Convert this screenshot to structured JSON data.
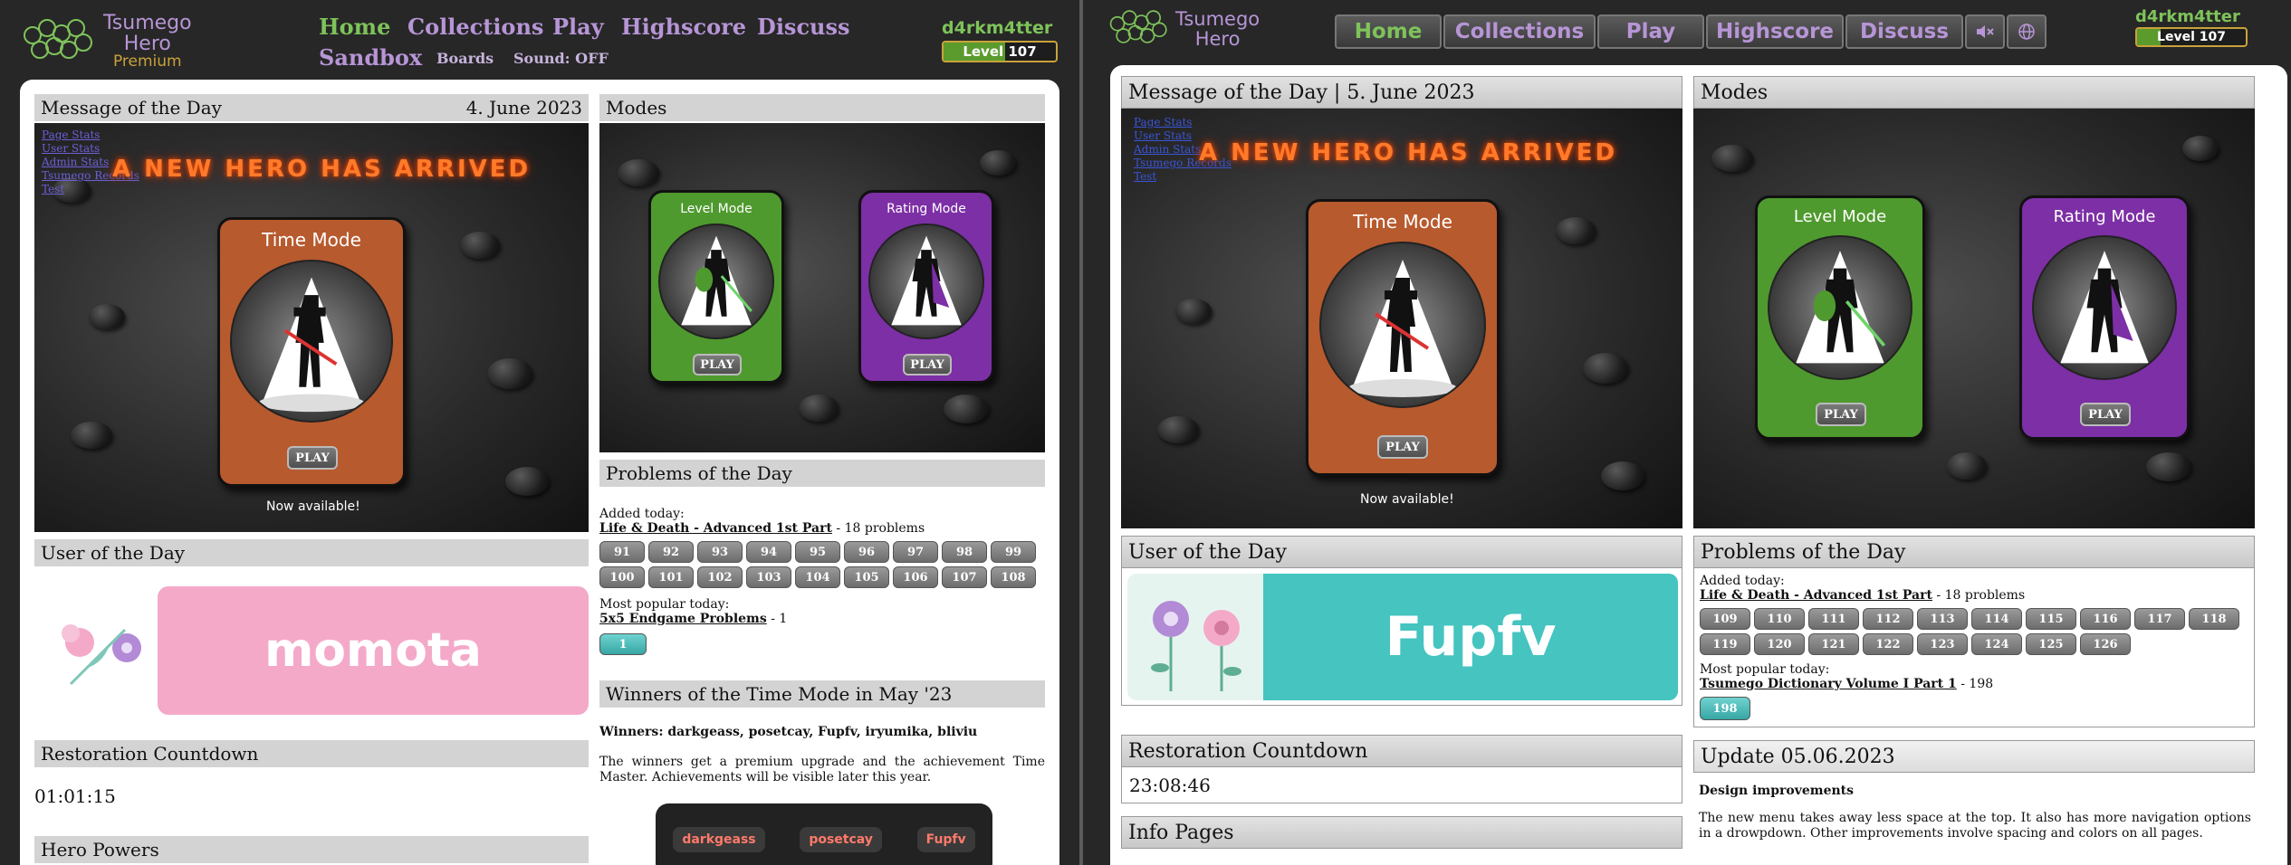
{
  "left": {
    "logo": {
      "line1": "Tsumego",
      "line2": "Hero",
      "line3": "Premium"
    },
    "nav": {
      "home": "Home",
      "collections": "Collections",
      "play": "Play",
      "highscore": "Highscore",
      "discuss": "Discuss",
      "sandbox": "Sandbox",
      "boards": "Boards",
      "sound": "Sound: OFF"
    },
    "user": {
      "name": "d4rkm4tter",
      "level": "Level 107",
      "level_progress": 0.55
    },
    "motd": {
      "title": "Message of the Day",
      "date": "4. June 2023",
      "headline": "A NEW HERO HAS ARRIVED",
      "card_title": "Time Mode",
      "play": "PLAY",
      "caption": "Now available!",
      "links": [
        "Page Stats",
        "User Stats",
        "Admin Stats",
        "Tsumego Records",
        "Test"
      ]
    },
    "modes": {
      "title": "Modes",
      "level_mode": "Level Mode",
      "rating_mode": "Rating Mode",
      "play": "PLAY"
    },
    "user_of_day": {
      "title": "User of the Day",
      "name": "momota"
    },
    "restoration": {
      "title": "Restoration Countdown",
      "time": "01:01:15"
    },
    "hero_powers": {
      "title": "Hero Powers"
    },
    "problems": {
      "title": "Problems of the Day",
      "added_label": "Added today:",
      "collection": "Life & Death - Advanced 1st Part",
      "count": " - 18 problems",
      "row1": [
        "91",
        "92",
        "93",
        "94",
        "95",
        "96",
        "97",
        "98",
        "99"
      ],
      "row2": [
        "100",
        "101",
        "102",
        "103",
        "104",
        "105",
        "106",
        "107",
        "108"
      ],
      "popular_label": "Most popular today:",
      "popular_collection": "5x5 Endgame Problems",
      "popular_count": " - 1",
      "popular_btn": "1"
    },
    "winners": {
      "title": "Winners of the Time Mode in May '23",
      "names": "Winners: darkgeass, posetcay, Fupfv, iryumika, bliviu",
      "text": "The winners get a premium upgrade and the achievement Time Master. Achievements will be visible later this year.",
      "badges": [
        "darkgeass",
        "posetcay",
        "Fupfv"
      ]
    }
  },
  "right": {
    "logo": {
      "line1": "Tsumego",
      "line2": "Hero"
    },
    "nav": [
      "Home",
      "Collections",
      "Play",
      "Highscore",
      "Discuss"
    ],
    "user": {
      "name": "d4rkm4tter",
      "level": "Level 107",
      "level_progress": 0.22
    },
    "motd": {
      "title": "Message of the Day | 5. June 2023",
      "headline": "A NEW HERO HAS ARRIVED",
      "card_title": "Time Mode",
      "play": "PLAY",
      "caption": "Now available!",
      "links": [
        "Page Stats",
        "User Stats",
        "Admin Stats",
        "Tsumego Records",
        "Test"
      ]
    },
    "modes": {
      "title": "Modes",
      "level_mode": "Level Mode",
      "rating_mode": "Rating Mode",
      "play": "PLAY"
    },
    "user_of_day": {
      "title": "User of the Day",
      "name": "Fupfv"
    },
    "restoration": {
      "title": "Restoration Countdown",
      "time": "23:08:46"
    },
    "info_pages": {
      "title": "Info Pages"
    },
    "problems": {
      "title": "Problems of the Day",
      "added_label": "Added today:",
      "collection": "Life & Death - Advanced 1st Part",
      "count": " - 18 problems",
      "row1": [
        "109",
        "110",
        "111",
        "112",
        "113",
        "114",
        "115",
        "116",
        "117",
        "118"
      ],
      "row2": [
        "119",
        "120",
        "121",
        "122",
        "123",
        "124",
        "125",
        "126"
      ],
      "popular_label": "Most popular today:",
      "popular_collection": "Tsumego Dictionary Volume I Part 1",
      "popular_count": " - 198",
      "popular_btn": "198"
    },
    "update": {
      "title": "Update 05.06.2023",
      "subtitle": "Design improvements",
      "text": "The new menu takes away less space at the top. It also has more navigation options in a drowpdown. Other improvements involve spacing and colors on all pages."
    }
  },
  "colors": {
    "accent_green": "#7ec35a",
    "accent_purple": "#b795d6",
    "time_card": "#b75a2e",
    "level_card": "#4f9a2e",
    "rating_card": "#7d2fa5",
    "teal": "#45bcb9",
    "pink_banner": "#f4a9c9",
    "teal_banner": "#45c4c0"
  }
}
